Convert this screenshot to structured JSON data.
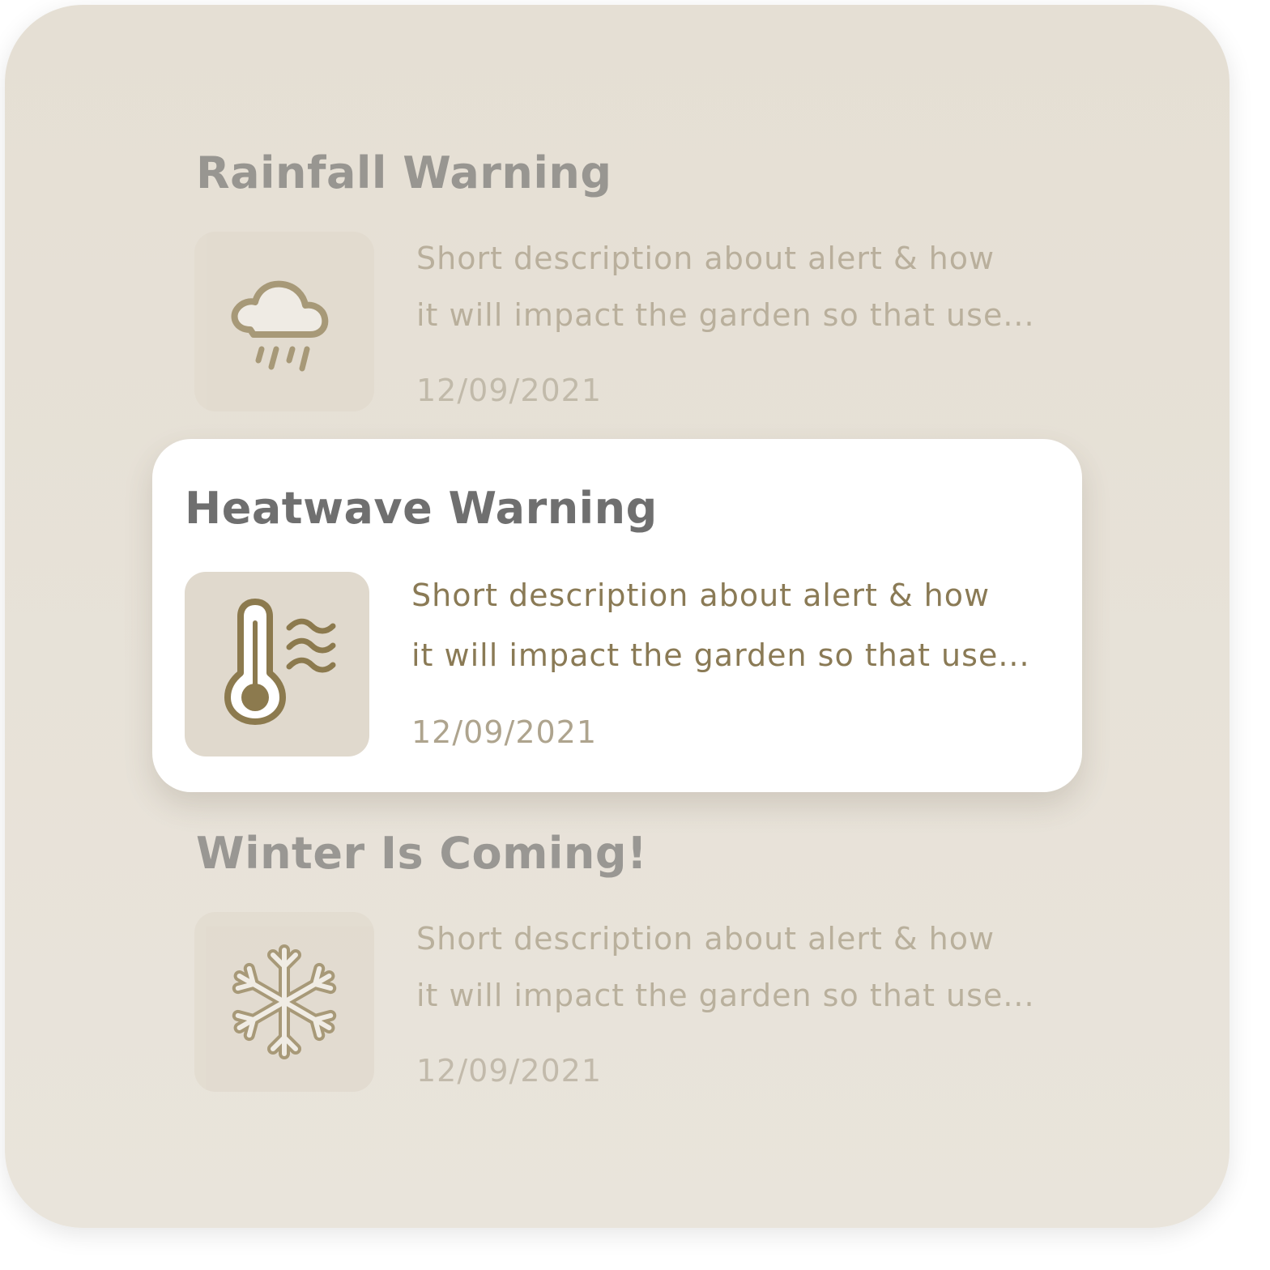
{
  "colors": {
    "panel_background": "#e7e1d8",
    "accent_brown": "#8c7a4e",
    "card_background": "#ffffff"
  },
  "alerts": [
    {
      "title": "Rainfall Warning",
      "description_line1": "Short description about alert & how",
      "description_line2": "it will impact the garden so that use...",
      "date": "12/09/2021",
      "icon": "cloud-rain-icon",
      "state": "inactive"
    },
    {
      "title": "Heatwave Warning",
      "description_line1": "Short description about alert & how",
      "description_line2": "it will impact the garden so that use...",
      "date": "12/09/2021",
      "icon": "thermometer-heat-icon",
      "state": "active"
    },
    {
      "title": "Winter Is Coming!",
      "description_line1": "Short description about alert & how",
      "description_line2": "it will impact the garden so that use...",
      "date": "12/09/2021",
      "icon": "snowflake-icon",
      "state": "inactive"
    }
  ]
}
